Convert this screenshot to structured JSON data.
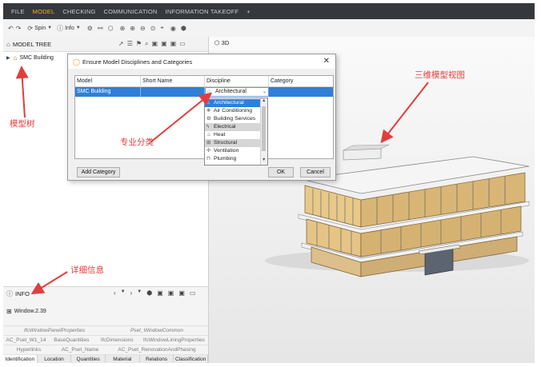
{
  "menubar": {
    "items": [
      "FILE",
      "MODEL",
      "CHECKING",
      "COMMUNICATION",
      "INFORMATION TAKEOFF",
      "+"
    ],
    "active": "MODEL"
  },
  "toolbar": {
    "spin_label": "Spin",
    "info_label": "Info"
  },
  "model_tree": {
    "title": "MODEL TREE",
    "items": [
      {
        "label": "SMC Building",
        "icon": "building-icon"
      }
    ],
    "view_3d_label": "3D"
  },
  "info": {
    "title": "INFO",
    "element": "Window.2.39",
    "tabs_row1": [
      "IfcWindowPanelProperties",
      "Pset_WindowCommon"
    ],
    "tabs_row2": [
      "AC_Pset_W1_14",
      "BaseQuantities",
      "IfcDimensions",
      "IfcWindowLiningProperties"
    ],
    "tabs_row3": [
      "Hyperlinks",
      "AC_Pset_Name",
      "AC_Pset_RenovationAndPhasing"
    ],
    "tabs_bottom": [
      "Identification",
      "Location",
      "Quantities",
      "Material",
      "Relations",
      "Classification"
    ],
    "active_tab": "Identification"
  },
  "dialog": {
    "title": "Ensure Model Disciplines and Categories",
    "columns": [
      "Model",
      "Short Name",
      "Discipline",
      "Category"
    ],
    "row": {
      "model": "SMC Building",
      "short_name": "",
      "discipline": "Architectural",
      "category": ""
    },
    "discipline_options": [
      "Architectural",
      "Air Conditioning",
      "Building Services",
      "Electrical",
      "Heat",
      "Structural",
      "Ventilation",
      "Plumbing"
    ],
    "selected_option": "Architectural",
    "add_category_label": "Add Category",
    "ok_label": "OK",
    "cancel_label": "Cancel"
  },
  "annotations": {
    "model_tree": "模型树",
    "discipline": "专业分类",
    "view_3d": "三维模型视图",
    "details": "详细信息"
  },
  "colors": {
    "menubar_bg": "#35383d",
    "menu_active": "#f0b429",
    "selection": "#2f7fd8",
    "annotation": "#e33d3d"
  }
}
